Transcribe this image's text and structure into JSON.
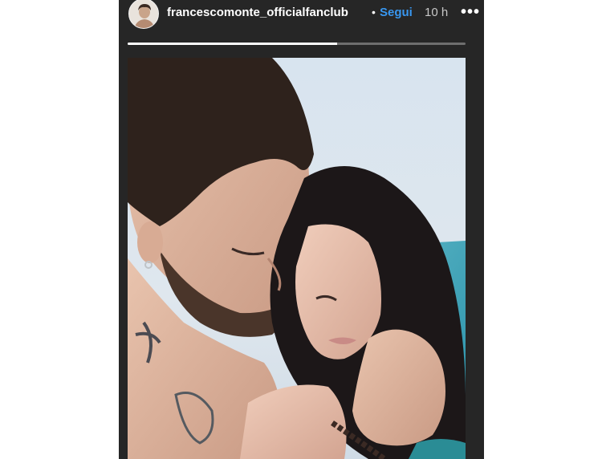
{
  "story": {
    "username": "francescomonte_officialfanclub",
    "separator": "•",
    "follow_label": "Segui",
    "timestamp": "10 h",
    "more_label": "•••",
    "progress": 0.62,
    "photo_alt": "couple-embrace-photo"
  },
  "colors": {
    "background": "#262626",
    "follow": "#3897f0",
    "progress_track": "#6e6e6e",
    "progress_fill": "#ffffff"
  }
}
